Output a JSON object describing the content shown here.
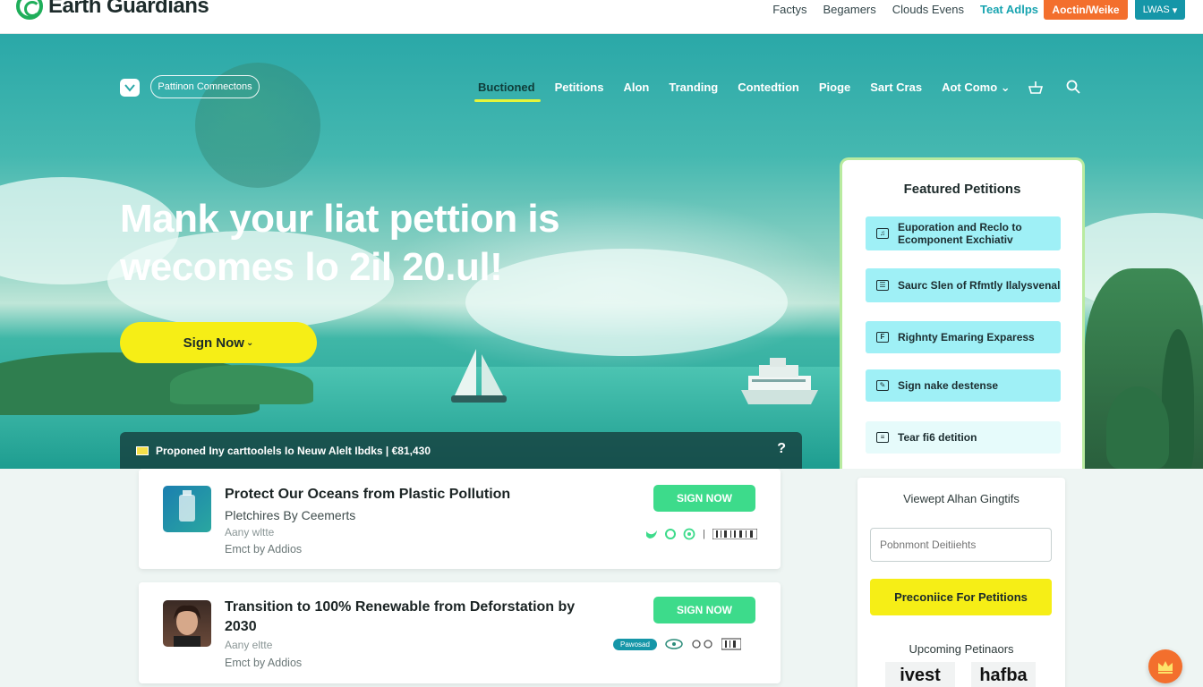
{
  "brand": {
    "name": "Earth Guardians"
  },
  "topbar": {
    "links": [
      "Factys",
      "Begamers",
      "Clouds Evens",
      "Teat Adlps"
    ],
    "orange_button": "Aoctin/Weike",
    "teal_button": "LWAS"
  },
  "hero": {
    "nav_pill": "Pattinon Comnectons",
    "nav_links": [
      "Buctioned",
      "Petitions",
      "Alon",
      "Tranding",
      "Contedtion",
      "Pioge",
      "Sart Cras",
      "Aot Como"
    ],
    "nav_more_arrow": "⌄",
    "title_line1": "Mank your liat pettion is",
    "title_line2": "wecomes lo 2il 20.ul!",
    "cta": "Sign Now",
    "banner_text": "Proponed Iny carttoolels Io Neuw Alelt Ibdks | €81,430",
    "banner_help": "?"
  },
  "featured": {
    "title": "Featured Petitions",
    "items": [
      "Euporation and Reclo to Ecomponent Exchiativ",
      "Saurc Slen of Rfmtly Ilalysvenal",
      "Righnty Emaring Exparess",
      "Sign nake destense",
      "Tear fi6 detition"
    ]
  },
  "cards": [
    {
      "title": "Protect Our Oceans from Plastic Pollution",
      "subtitle": "Pletchires By Ceemerts",
      "meta": "Aany wltte",
      "by": "Emct by Addios",
      "button": "SIGN NOW"
    },
    {
      "title": "Transition to 100% Renewable from Deforstation by 2030",
      "meta": "Aany eltte",
      "by": "Emct by Addios",
      "button": "SIGN NOW",
      "badge": "Pawosad"
    }
  ],
  "sidebar": {
    "title": "Viewept Alhan Gingtifs",
    "input_placeholder": "Pobnmont Deitiiehts",
    "button": "Preconiice For Petitions",
    "upcoming": "Upcoming Petinaors",
    "logos": [
      "ivest",
      "hafba"
    ]
  },
  "colors": {
    "accent_yellow": "#f6ee16",
    "accent_green": "#3ddb8b",
    "accent_orange": "#f36f2d",
    "accent_teal": "#1596a8"
  }
}
